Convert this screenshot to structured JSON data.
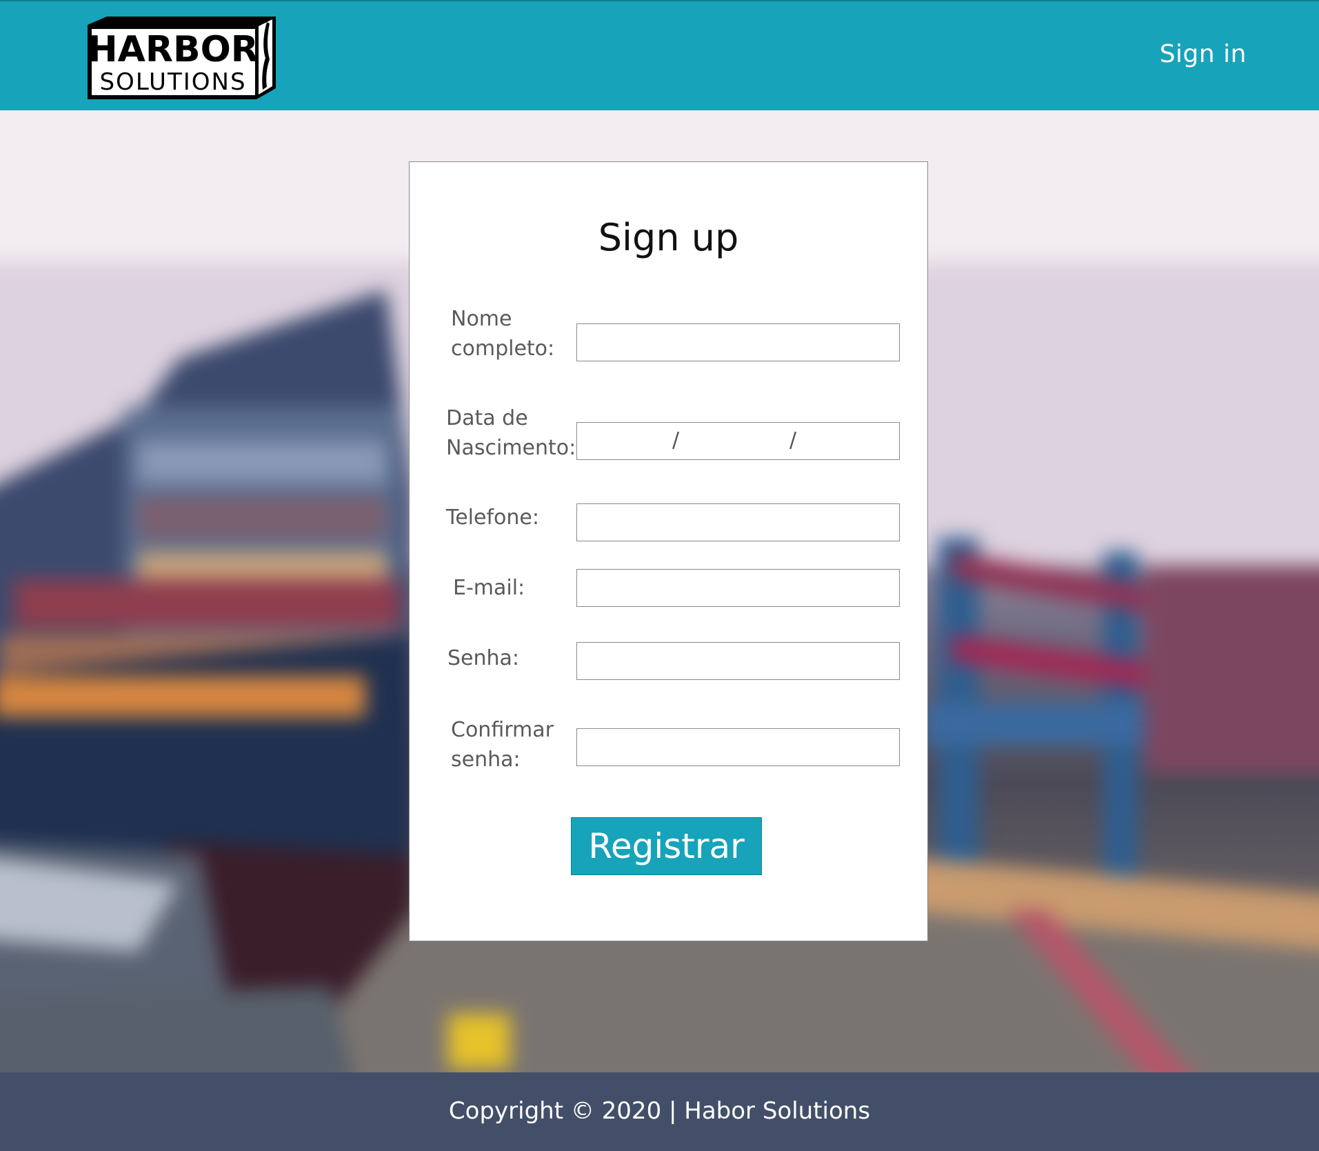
{
  "header": {
    "logo_line1": "HARBOR",
    "logo_line2": "SOLUTIONS",
    "signin_label": "Sign in",
    "background_color": "#17a3ba"
  },
  "form": {
    "title": "Sign up",
    "fields": [
      {
        "label_line1": "Nome",
        "label_line2": "completo:",
        "value": "",
        "type": "text"
      },
      {
        "label_line1": "Data de",
        "label_line2": "Nascimento:",
        "value": "",
        "type": "date",
        "separator": "/"
      },
      {
        "label": "Telefone:",
        "value": "",
        "type": "tel"
      },
      {
        "label": "E-mail:",
        "value": "",
        "type": "email"
      },
      {
        "label": "Senha:",
        "value": "",
        "type": "password"
      },
      {
        "label_line1": "Confirmar",
        "label_line2": "senha:",
        "value": "",
        "type": "password"
      }
    ],
    "submit_label": "Registrar",
    "accent_color": "#17a3ba"
  },
  "footer": {
    "text": "Copyright © 2020 | Habor Solutions",
    "background_color": "#434f69"
  },
  "background": {
    "icon": "blurred-port-photo"
  }
}
